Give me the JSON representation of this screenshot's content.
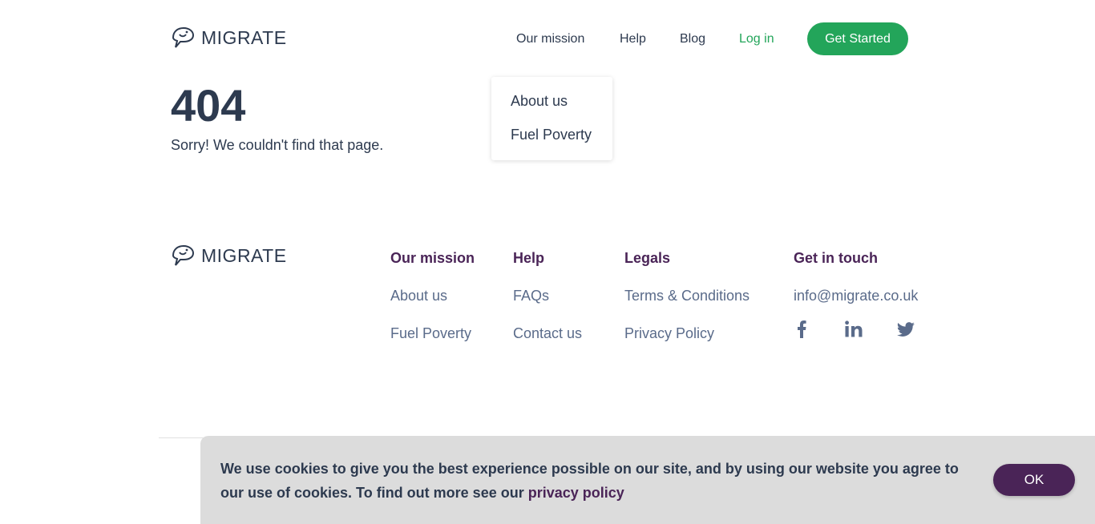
{
  "brand": {
    "name": "MIGRATE",
    "accent": "#23a55a",
    "secondary": "#4a2457"
  },
  "nav": {
    "items": [
      "Our mission",
      "Help",
      "Blog"
    ],
    "login": "Log in",
    "cta": "Get Started"
  },
  "dropdown": {
    "items": [
      "About us",
      "Fuel Poverty"
    ]
  },
  "error": {
    "code": "404",
    "message": "Sorry! We couldn't find that page."
  },
  "footer": {
    "columns": [
      {
        "title": "Our mission",
        "links": [
          "About us",
          "Fuel Poverty"
        ]
      },
      {
        "title": "Help",
        "links": [
          "FAQs",
          "Contact us"
        ]
      },
      {
        "title": "Legals",
        "links": [
          "Terms & Conditions",
          "Privacy Policy"
        ]
      },
      {
        "title": "Get in touch",
        "links": [
          "info@migrate.co.uk"
        ]
      }
    ],
    "socials": [
      "facebook-icon",
      "linkedin-icon",
      "twitter-icon"
    ]
  },
  "cookie": {
    "text": "We use cookies to give you the best experience possible on our site, and by using our website you agree to our use of cookies. To find out more see our",
    "link": "privacy policy",
    "button": "OK"
  }
}
